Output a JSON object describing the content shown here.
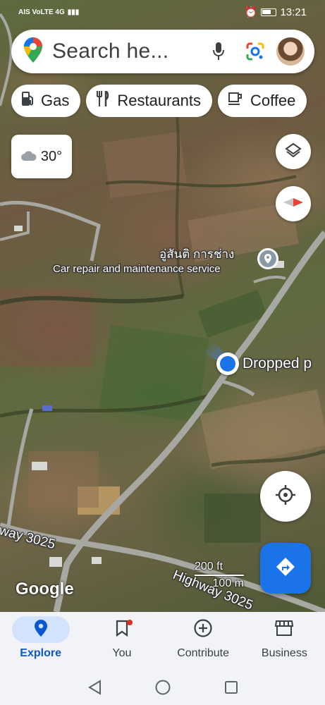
{
  "status_bar": {
    "left_text": "AIS VoLTE 4G",
    "time": "13:21"
  },
  "search": {
    "placeholder": "Search he...",
    "icons": [
      "google-maps-pin-icon",
      "microphone-icon",
      "google-lens-icon",
      "avatar"
    ]
  },
  "chips": [
    {
      "label": "Gas",
      "icon": "gas-pump-icon"
    },
    {
      "label": "Restaurants",
      "icon": "fork-knife-icon"
    },
    {
      "label": "Coffee",
      "icon": "coffee-cup-icon"
    }
  ],
  "weather": {
    "temperature": "30°",
    "icon": "cloud-icon"
  },
  "map": {
    "place_name": "อู่สันติ การช่าง",
    "place_category": "Car repair and maintenance service",
    "dropped_pin_label": "Dropped p",
    "road_label_a": "way 3025",
    "road_label_b": "Highway 3025",
    "scale_top": "200 ft",
    "scale_bottom": "100 m",
    "logo": "Google"
  },
  "bottom_nav": [
    {
      "label": "Explore",
      "icon": "explore-pin-icon",
      "active": true
    },
    {
      "label": "You",
      "icon": "bookmark-icon",
      "active": false
    },
    {
      "label": "Contribute",
      "icon": "plus-circle-icon",
      "active": false
    },
    {
      "label": "Business",
      "icon": "storefront-icon",
      "active": false
    }
  ],
  "colors": {
    "accent": "#1a73e8",
    "active_nav_bg": "#d3e3fd",
    "active_nav_text": "#0b57d0"
  }
}
